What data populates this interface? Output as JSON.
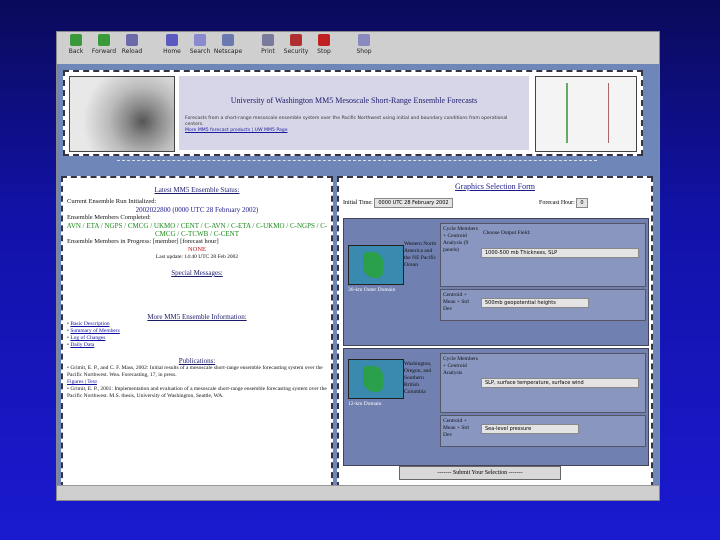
{
  "toolbar": {
    "buttons": [
      {
        "label": "Back",
        "icon": "back-icon"
      },
      {
        "label": "Forward",
        "icon": "forward-icon"
      },
      {
        "label": "Reload",
        "icon": "reload-icon"
      },
      {
        "label": "Home",
        "icon": "home-icon"
      },
      {
        "label": "Search",
        "icon": "search-icon"
      },
      {
        "label": "Netscape",
        "icon": "netscape-icon"
      },
      {
        "label": "Print",
        "icon": "print-icon"
      },
      {
        "label": "Security",
        "icon": "security-icon"
      },
      {
        "label": "Stop",
        "icon": "stop-icon"
      },
      {
        "label": "Shop",
        "icon": "shop-icon"
      }
    ]
  },
  "header": {
    "title": "University of Washington MM5 Mesoscale Short-Range Ensemble Forecasts",
    "desc": "Forecasts from a short-range mesoscale ensemble system over the Pacific Northwest using initial and boundary conditions from operational centers.",
    "link": "More MM5 forecast products | UW MM5 Page"
  },
  "left": {
    "status_head": "Latest MM5 Ensemble Status:",
    "current_line": "Current Ensemble Run Initialized:",
    "init_id": "2002022800 (0000 UTC 28 February 2002)",
    "members_done_label": "Ensemble Members Completed:",
    "members_done": "AVN / ETA / NGPS / CMCG / UKMO / CENT / C-AVN / C-ETA / C-UKMO / C-NGPS / C-CMCG / C-TCWB / C-CENT",
    "in_progress_label": "Ensemble Members in Progress: [member] [forecast hour]",
    "none": "NONE",
    "last_update": "Last update: 14:40 UTC 28 Feb 2002",
    "special_head": "Special Messages:",
    "more_head": "More MM5 Ensemble Information:",
    "more_items": [
      "Basic Description",
      "Summary of Members",
      "Log of Changes",
      "Daily Data"
    ],
    "pubs_head": "Publications:",
    "pubs": [
      "Grimit, E. P., and C. F. Mass, 2002: Initial results of a mesoscale short-range ensemble forecasting system over the Pacific Northwest. Wea. Forecasting, 17, in press.",
      "Figures | Text",
      "Grimit, E. P., 2001: Implementation and evaluation of a mesoscale short-range ensemble forecasting system over the Pacific Northwest. M.S. thesis, University of Washington, Seattle, WA."
    ]
  },
  "right": {
    "form_title": "Graphics Selection Form",
    "init_label": "Initial Time:",
    "init_value": "0000 UTC 28 February 2002",
    "fhour_label": "Forecast Hour:",
    "fhour_value": "0",
    "domain1": "36-km Outer Domain",
    "domain1_name": "Western North America and the NE Pacific Ocean",
    "radio1": "Cycle Members + Centroid Analysis (9 panels)",
    "radio1b": "Centroid + Mean + Std Dev",
    "field_label": "Choose Output Field:",
    "field1": "1000-500 mb Thickness, SLP",
    "field1b": "500mb geopotential heights",
    "domain2": "12-km Domain",
    "domain2_name": "Washington, Oregon, and Southern British Columbia",
    "radio2": "Cycle Members + Centroid Analysis",
    "radio2b": "Centroid + Mean + Std Dev",
    "field2": "SLP, surface temperature, surface wind",
    "field2b": "Sea-level pressure",
    "submit": "------- Submit Your Selection -------"
  }
}
